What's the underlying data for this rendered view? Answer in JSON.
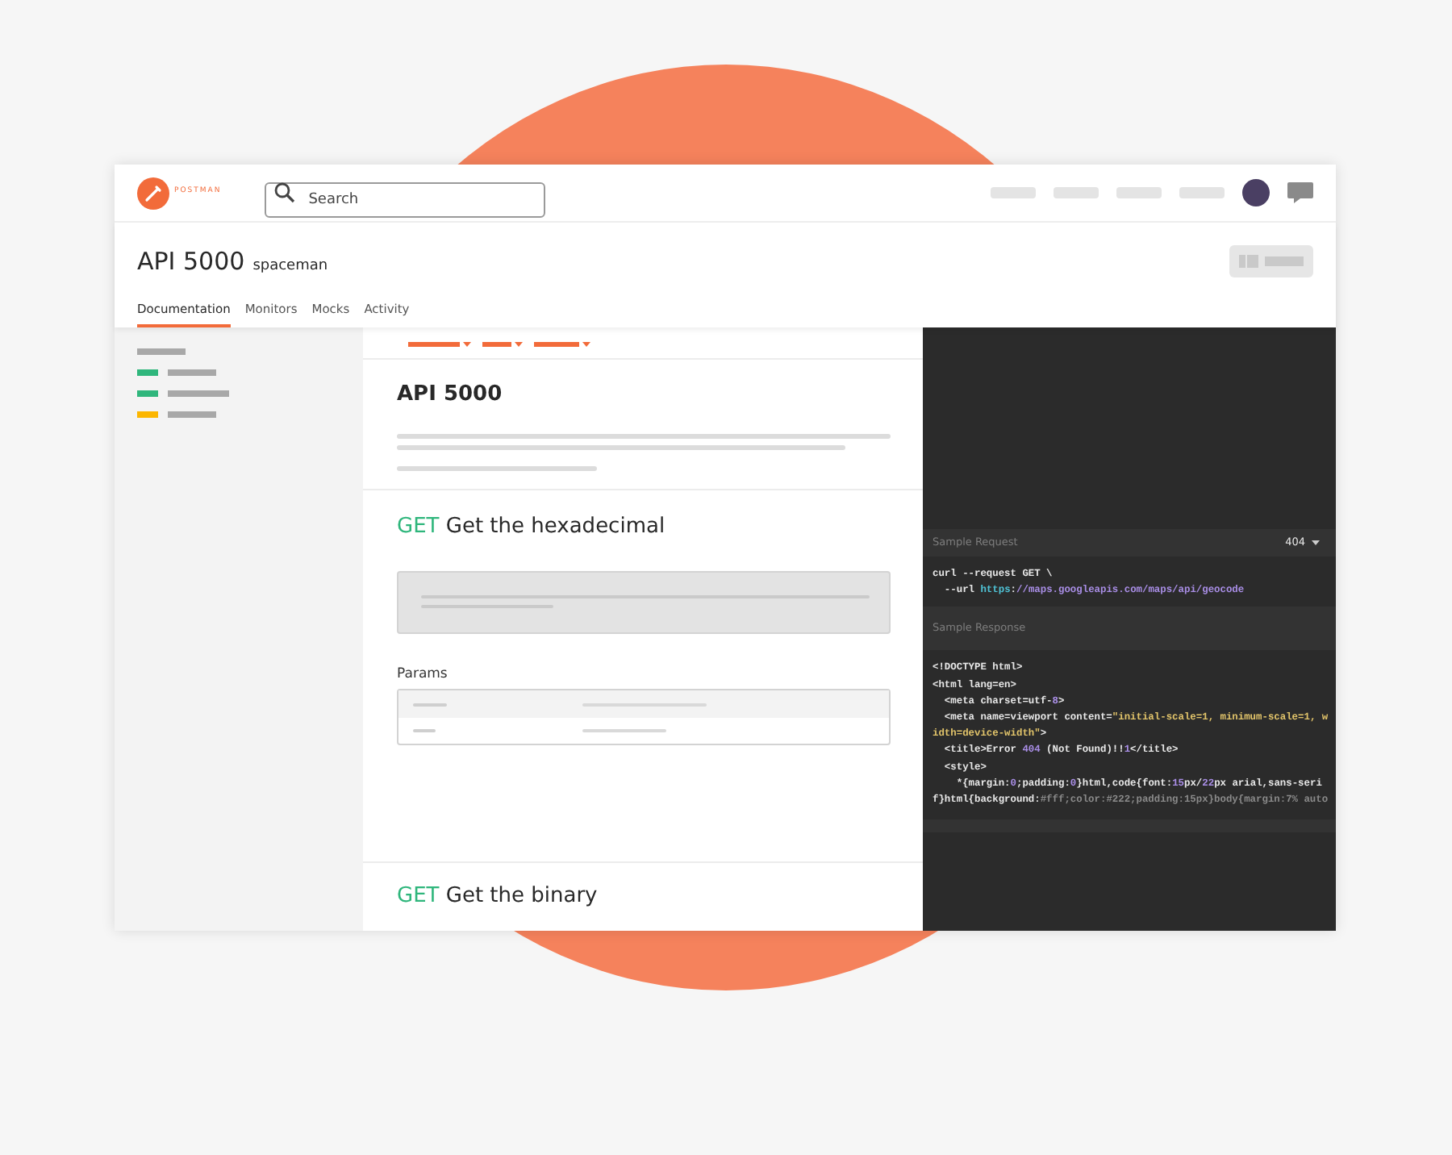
{
  "logo": {
    "text": "POSTMAN"
  },
  "search": {
    "placeholder": "Search"
  },
  "header": {
    "title": "API 5000",
    "owner": "spaceman"
  },
  "tabs": [
    {
      "label": "Documentation",
      "selected": true
    },
    {
      "label": "Monitors",
      "selected": false
    },
    {
      "label": "Mocks",
      "selected": false
    },
    {
      "label": "Activity",
      "selected": false
    }
  ],
  "sidebar": {
    "items": [
      {
        "color": "#2fb67c"
      },
      {
        "color": "#2fb67c"
      },
      {
        "color": "#fcb600"
      }
    ]
  },
  "doc": {
    "title": "API 5000"
  },
  "endpoints": [
    {
      "method": "GET",
      "name": "Get the hexadecimal",
      "params_label": "Params"
    },
    {
      "method": "GET",
      "name": "Get the binary"
    }
  ],
  "sample_request": {
    "label": "Sample Request",
    "status": "404",
    "lines": [
      [
        {
          "kind": "plain",
          "text": "curl --request GET \\"
        }
      ],
      [
        {
          "kind": "plain",
          "text": "  --url "
        },
        {
          "kind": "scheme",
          "text": "https"
        },
        {
          "kind": "plain",
          "text": ":"
        },
        {
          "kind": "url",
          "text": "//maps.googleapis.com/maps/api/geocode"
        }
      ]
    ]
  },
  "sample_response": {
    "label": "Sample Response",
    "lines": [
      [
        {
          "kind": "plain",
          "text": "<!DOCTYPE html>"
        }
      ],
      [
        {
          "kind": "plain",
          "text": "<html lang=en>"
        }
      ],
      [
        {
          "kind": "plain",
          "text": "  <meta charset=utf-"
        },
        {
          "kind": "number",
          "text": "8"
        },
        {
          "kind": "plain",
          "text": ">"
        }
      ],
      [
        {
          "kind": "plain",
          "text": "  <meta name=viewport content="
        },
        {
          "kind": "string",
          "text": "\"initial-scale=1, minimum-scale=1, w"
        }
      ],
      [
        {
          "kind": "string",
          "text": "idth=device-width\""
        },
        {
          "kind": "plain",
          "text": ">"
        }
      ],
      [
        {
          "kind": "plain",
          "text": "  <title>Error "
        },
        {
          "kind": "number",
          "text": "404"
        },
        {
          "kind": "plain",
          "text": " (Not Found)!!"
        },
        {
          "kind": "number",
          "text": "1"
        },
        {
          "kind": "plain",
          "text": "</title>"
        }
      ],
      [
        {
          "kind": "plain",
          "text": "  <style>"
        }
      ],
      [
        {
          "kind": "plain",
          "text": "    *{margin:"
        },
        {
          "kind": "number",
          "text": "0"
        },
        {
          "kind": "plain",
          "text": ";padding:"
        },
        {
          "kind": "number",
          "text": "0"
        },
        {
          "kind": "plain",
          "text": "}html,code{font:"
        },
        {
          "kind": "number",
          "text": "15"
        },
        {
          "kind": "plain",
          "text": "px/"
        },
        {
          "kind": "number",
          "text": "22"
        },
        {
          "kind": "plain",
          "text": "px arial,sans-seri"
        }
      ],
      [
        {
          "kind": "plain",
          "text": "f}html{background:"
        },
        {
          "kind": "muted",
          "text": "#fff;color:#222;padding:15px}body{margin:7% auto"
        }
      ]
    ]
  }
}
